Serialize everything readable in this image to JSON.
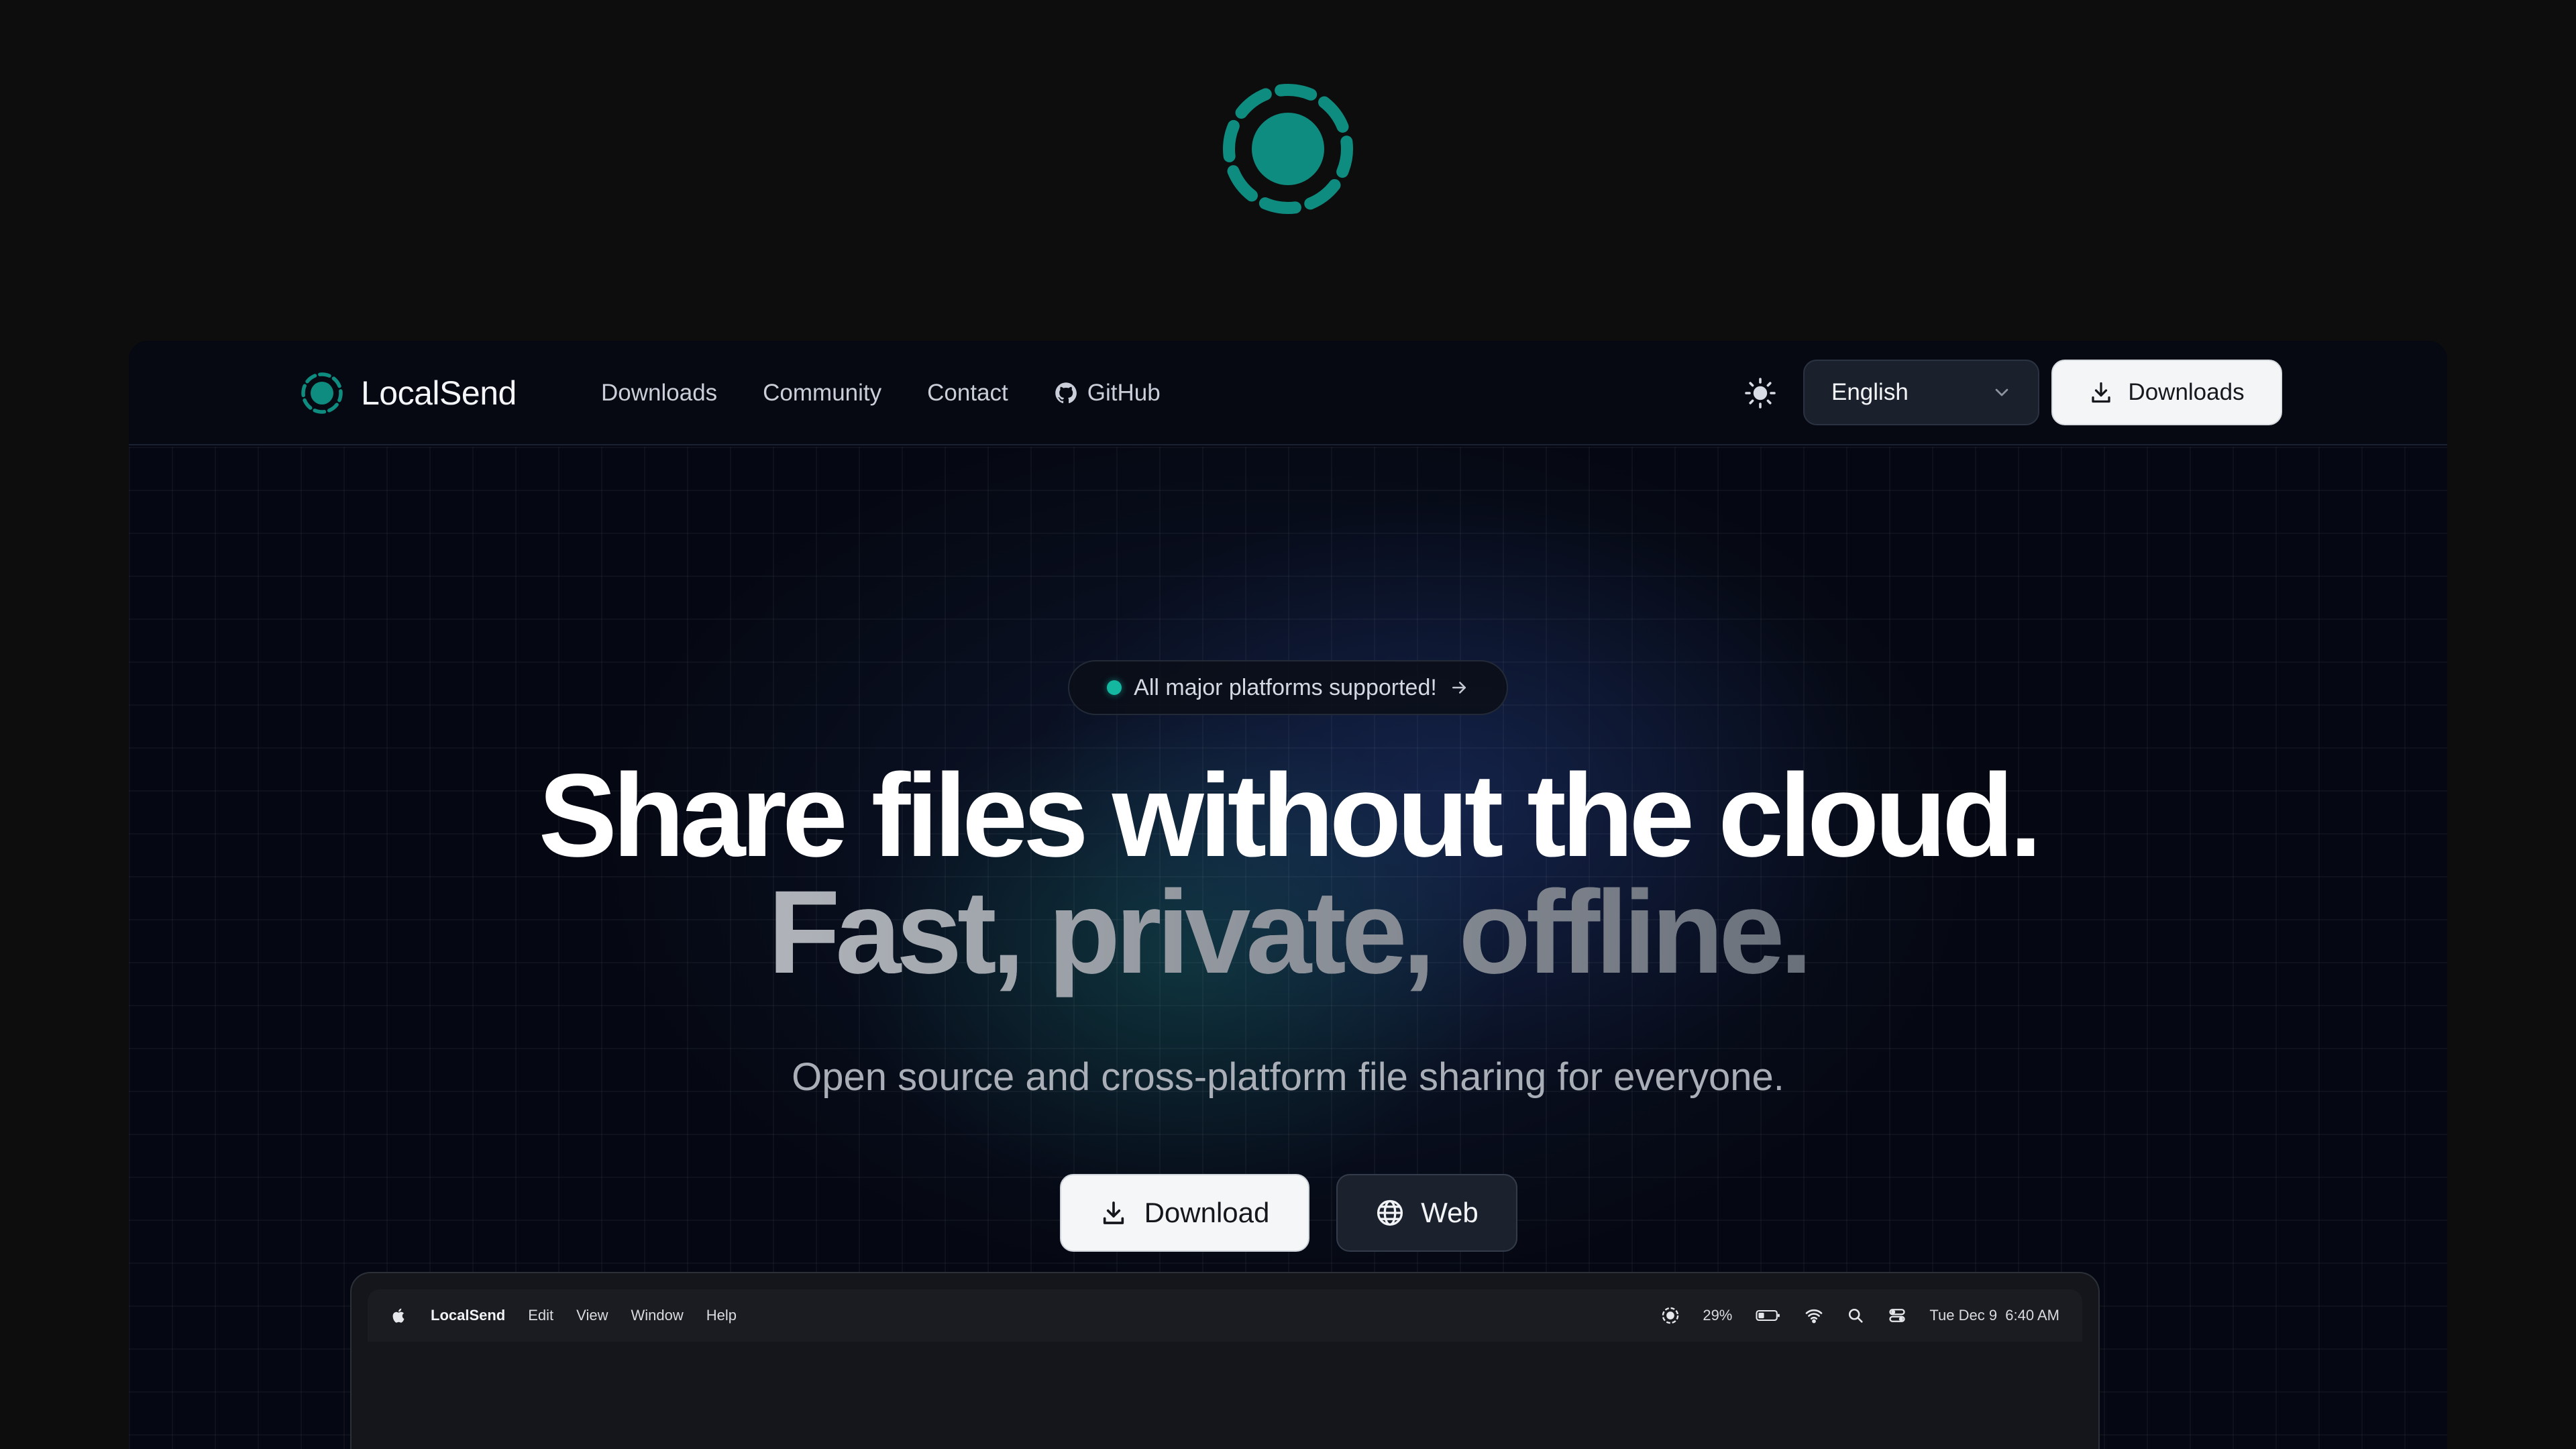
{
  "brand": {
    "name": "LocalSend",
    "accent": "#0f8c80"
  },
  "nav": {
    "items": [
      {
        "label": "Downloads"
      },
      {
        "label": "Community"
      },
      {
        "label": "Contact"
      },
      {
        "label": "GitHub",
        "icon": "github-icon"
      }
    ]
  },
  "header": {
    "theme_icon": "sun-icon",
    "language": "English",
    "download_label": "Downloads"
  },
  "hero": {
    "badge": "All major platforms supported!",
    "headline": "Share files without the cloud.",
    "subheadline": "Fast, private, offline.",
    "tagline": "Open source and cross-platform file sharing for everyone.",
    "download_label": "Download",
    "web_label": "Web"
  },
  "mock_menubar": {
    "app": "LocalSend",
    "menus": [
      "Edit",
      "View",
      "Window",
      "Help"
    ],
    "battery": "29%",
    "datetime": "Tue Dec 9  6:40 AM"
  }
}
